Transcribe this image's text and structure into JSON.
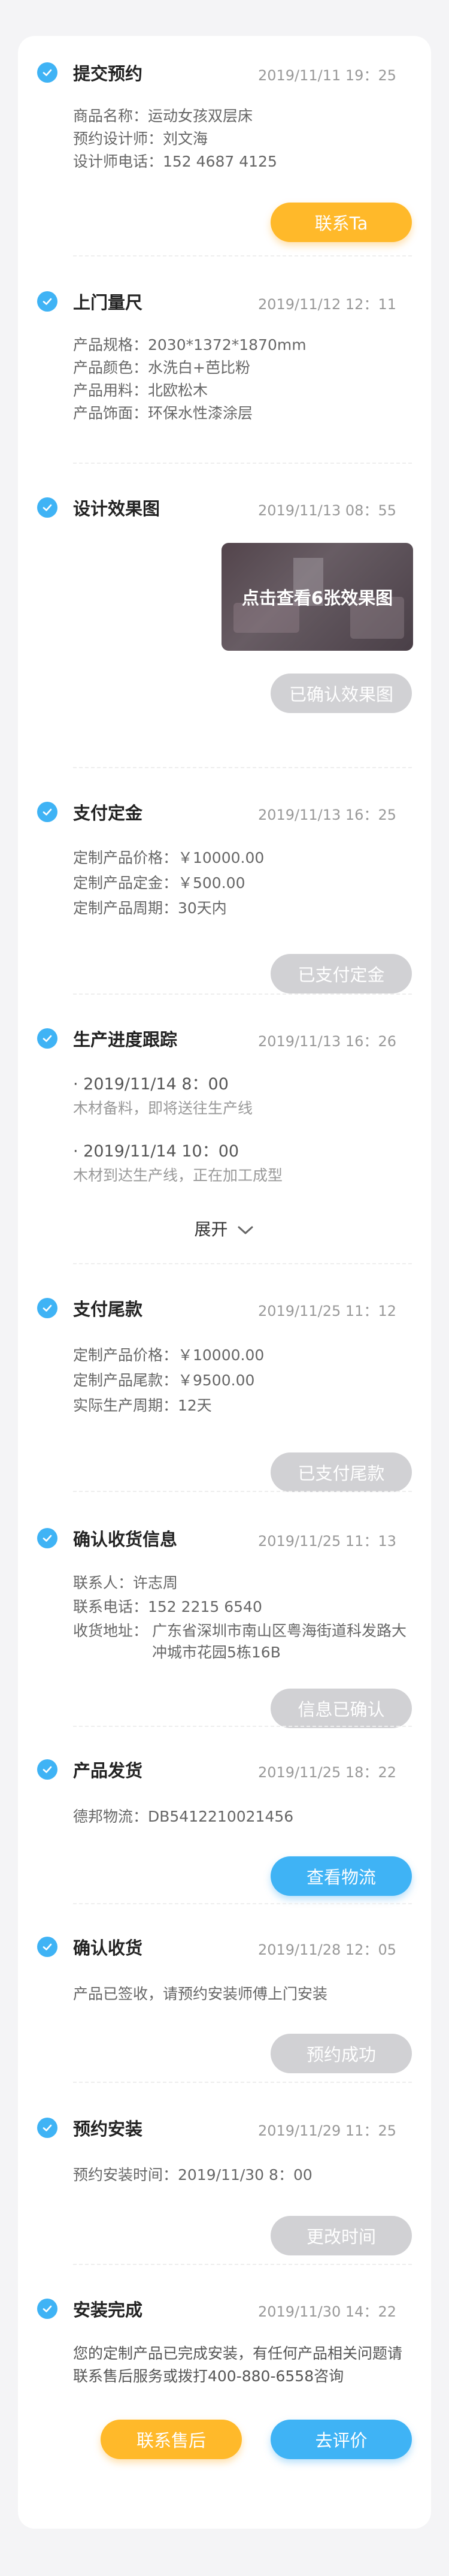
{
  "steps": {
    "submit": {
      "title": "提交预约",
      "time": "2019/11/11  19：25",
      "rows": [
        "商品名称：运动女孩双层床",
        "预约设计师：刘文海",
        "设计师电话：152 4687 4125"
      ],
      "button": "联系Ta"
    },
    "measure": {
      "title": "上门量尺",
      "time": "2019/11/12  12：11",
      "rows": [
        "产品规格：2030*1372*1870mm",
        "产品颜色：水洗白+芭比粉",
        "产品用料：北欧松木",
        "产品饰面：环保水性漆涂层"
      ]
    },
    "design": {
      "title": "设计效果图",
      "time": "2019/11/13  08：55",
      "preview_label": "点击查看6张效果图",
      "button": "已确认效果图"
    },
    "deposit": {
      "title": "支付定金",
      "time": "2019/11/13  16：25",
      "rows": [
        "定制产品价格：￥10000.00",
        "定制产品定金：￥500.00",
        "定制产品周期：30天内"
      ],
      "button": "已支付定金"
    },
    "production": {
      "title": "生产进度跟踪",
      "time": "2019/11/13  16：26",
      "entries": [
        {
          "time": "2019/11/14  8：00",
          "desc": "木材备料，即将送往生产线"
        },
        {
          "time": "2019/11/14  10：00",
          "desc": "木材到达生产线，正在加工成型"
        }
      ],
      "expand": "展开"
    },
    "balance": {
      "title": "支付尾款",
      "time": "2019/11/25  11：12",
      "rows": [
        "定制产品价格：￥10000.00",
        "定制产品尾款：￥9500.00",
        "实际生产周期：12天"
      ],
      "button": "已支付尾款"
    },
    "receipt_info": {
      "title": "确认收货信息",
      "time": "2019/11/25  11：13",
      "rows": [
        "联系人：许志周",
        "联系电话：152 2215 6540"
      ],
      "address_label": "收货地址：",
      "address": "广东省深圳市南山区粤海街道科发路大冲城市花园5栋16B",
      "button": "信息已确认"
    },
    "shipping": {
      "title": "产品发货",
      "time": "2019/11/25  18：22",
      "rows": [
        "德邦物流：DB5412210021456"
      ],
      "button": "查看物流"
    },
    "received": {
      "title": "确认收货",
      "time": "2019/11/28  12：05",
      "rows": [
        "产品已签收，请预约安装师傅上门安装"
      ],
      "button": "预约成功"
    },
    "install_booking": {
      "title": "预约安装",
      "time": "2019/11/29  11：25",
      "rows": [
        "预约安装时间：2019/11/30  8：00"
      ],
      "button": "更改时间"
    },
    "install_done": {
      "title": "安装完成",
      "time": "2019/11/30  14：22",
      "rows": [
        "您的定制产品已完成安装，有任何产品相关问题请",
        "联系售后服务或拨打400-880-6558咨询"
      ],
      "button_service": "联系售后",
      "button_review": "去评价"
    }
  },
  "colors": {
    "accent_blue": "#3fb3f5",
    "accent_orange": "#ffb92a",
    "disabled_gray": "#d1d1d4",
    "background": "#f4f4f6"
  },
  "icons": {
    "step_status": "check-circle-icon",
    "expand": "chevron-down-icon"
  }
}
